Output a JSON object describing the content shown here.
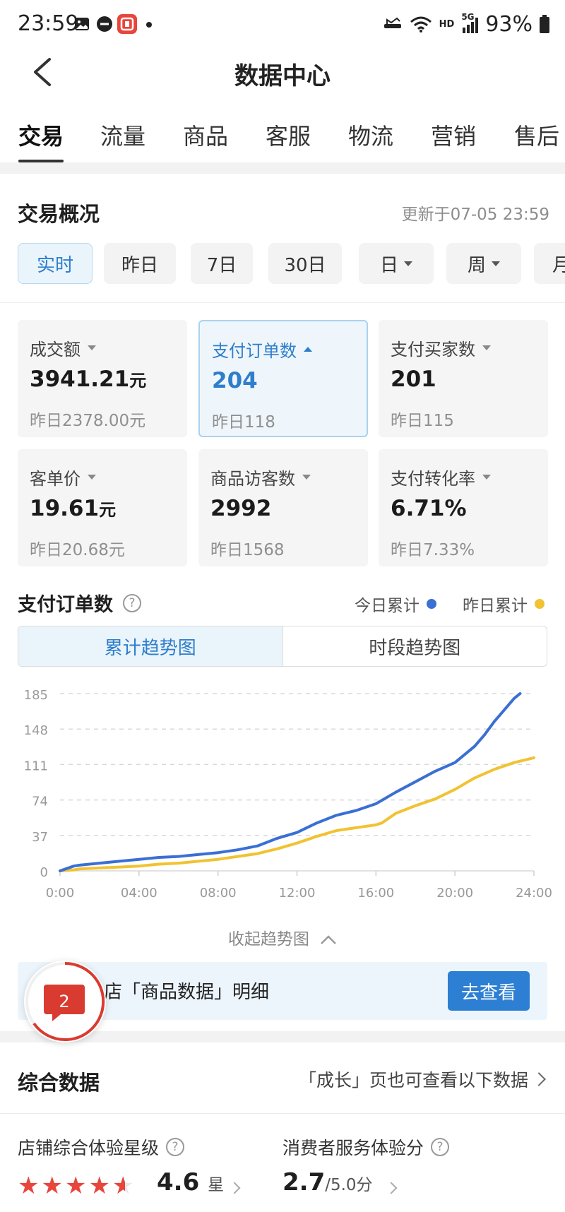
{
  "status_bar": {
    "time": "23:59",
    "battery": "93%",
    "signal_label": "5G",
    "hd_label": "HD"
  },
  "nav": {
    "title": "数据中心"
  },
  "tabs": [
    "交易",
    "流量",
    "商品",
    "客服",
    "物流",
    "营销",
    "售后"
  ],
  "overview": {
    "title": "交易概况",
    "update_time": "更新于07-05 23:59",
    "periods": [
      "实时",
      "昨日",
      "7日",
      "30日",
      "日",
      "周",
      "月"
    ]
  },
  "metrics": [
    {
      "label": "成交额",
      "value": "3941.21",
      "unit": "元",
      "prev": "昨日2378.00元"
    },
    {
      "label": "支付订单数",
      "value": "204",
      "unit": "",
      "prev": "昨日118"
    },
    {
      "label": "支付买家数",
      "value": "201",
      "unit": "",
      "prev": "昨日115"
    },
    {
      "label": "客单价",
      "value": "19.61",
      "unit": "元",
      "prev": "昨日20.68元"
    },
    {
      "label": "商品访客数",
      "value": "2992",
      "unit": "",
      "prev": "昨日1568"
    },
    {
      "label": "支付转化率",
      "value": "6.71%",
      "unit": "",
      "prev": "昨日7.33%"
    }
  ],
  "chart_header": {
    "title": "支付订单数",
    "help": "?",
    "legend_today": "今日累计",
    "legend_yesterday": "昨日累计",
    "seg_cumulative": "累计趋势图",
    "seg_hourly": "时段趋势图",
    "collapse_label": "收起趋势图"
  },
  "colors": {
    "today": "#3a6fd4",
    "yesterday": "#f1c232",
    "accent": "#2e7ecb",
    "brand_red": "#e8453c"
  },
  "chart_data": {
    "type": "line",
    "x_ticks": [
      "0:00",
      "04:00",
      "08:00",
      "12:00",
      "16:00",
      "20:00",
      "24:00"
    ],
    "y_ticks": [
      "0",
      "37",
      "74",
      "111",
      "148",
      "185"
    ],
    "ylim": [
      0,
      185
    ],
    "xlim": [
      0,
      24
    ],
    "grid": true,
    "legend": "top-right",
    "series": [
      {
        "name": "今日累计",
        "x": [
          0,
          0.7,
          1,
          2,
          3,
          4,
          5,
          6,
          7,
          8,
          9,
          10,
          11,
          12,
          13,
          14,
          15,
          16,
          17,
          18,
          19,
          20,
          21,
          21.5,
          22,
          22.5,
          23,
          23.3
        ],
        "values": [
          0,
          5,
          6,
          8,
          10,
          12,
          14,
          15,
          17,
          19,
          22,
          26,
          34,
          40,
          50,
          58,
          63,
          70,
          82,
          93,
          104,
          113,
          130,
          142,
          156,
          168,
          180,
          185
        ]
      },
      {
        "name": "昨日累计",
        "x": [
          0,
          0.7,
          1,
          2,
          3,
          4,
          5,
          6,
          7,
          8,
          9,
          10,
          11,
          12,
          13,
          14,
          15,
          16,
          16.3,
          17,
          18,
          19,
          20,
          21,
          22,
          23,
          24
        ],
        "values": [
          0,
          1,
          2,
          3,
          4,
          5,
          7,
          8,
          10,
          12,
          15,
          18,
          23,
          29,
          36,
          42,
          45,
          48,
          50,
          60,
          68,
          75,
          85,
          97,
          106,
          113,
          118
        ]
      }
    ]
  },
  "banner": {
    "text": "店「商品数据」明细",
    "button": "去查看",
    "badge_count": "2"
  },
  "comprehensive": {
    "title": "综合数据",
    "more_link": "「成长」页也可查看以下数据",
    "store_rating_label": "店铺综合体验星级",
    "store_rating_value": "4.6",
    "store_rating_unit": "星",
    "store_rating_stars": 4.6,
    "service_label": "消费者服务体验分",
    "service_value": "2.7",
    "service_max": "/5.0分"
  }
}
